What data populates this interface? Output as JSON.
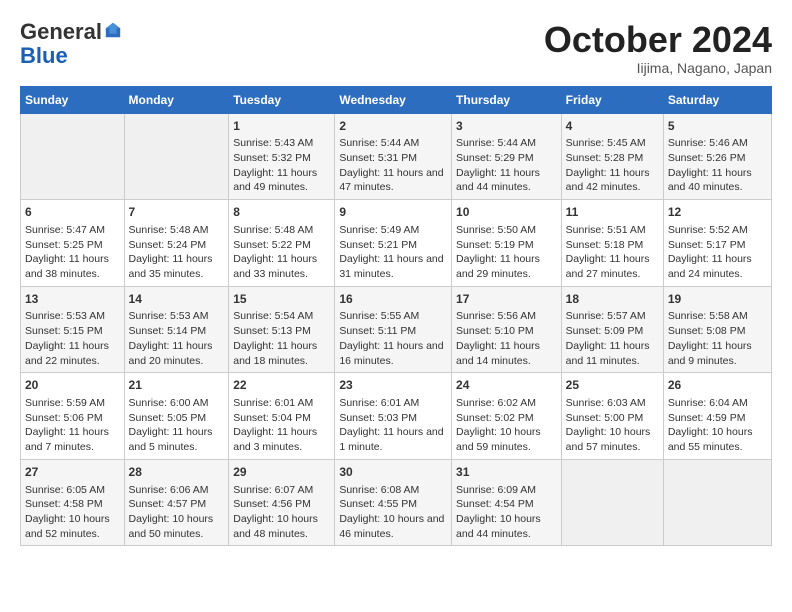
{
  "header": {
    "logo_line1": "General",
    "logo_line2": "Blue",
    "month_title": "October 2024",
    "location": "Iijima, Nagano, Japan"
  },
  "weekdays": [
    "Sunday",
    "Monday",
    "Tuesday",
    "Wednesday",
    "Thursday",
    "Friday",
    "Saturday"
  ],
  "weeks": [
    [
      {
        "day": "",
        "content": ""
      },
      {
        "day": "",
        "content": ""
      },
      {
        "day": "1",
        "content": "Sunrise: 5:43 AM\nSunset: 5:32 PM\nDaylight: 11 hours and 49 minutes."
      },
      {
        "day": "2",
        "content": "Sunrise: 5:44 AM\nSunset: 5:31 PM\nDaylight: 11 hours and 47 minutes."
      },
      {
        "day": "3",
        "content": "Sunrise: 5:44 AM\nSunset: 5:29 PM\nDaylight: 11 hours and 44 minutes."
      },
      {
        "day": "4",
        "content": "Sunrise: 5:45 AM\nSunset: 5:28 PM\nDaylight: 11 hours and 42 minutes."
      },
      {
        "day": "5",
        "content": "Sunrise: 5:46 AM\nSunset: 5:26 PM\nDaylight: 11 hours and 40 minutes."
      }
    ],
    [
      {
        "day": "6",
        "content": "Sunrise: 5:47 AM\nSunset: 5:25 PM\nDaylight: 11 hours and 38 minutes."
      },
      {
        "day": "7",
        "content": "Sunrise: 5:48 AM\nSunset: 5:24 PM\nDaylight: 11 hours and 35 minutes."
      },
      {
        "day": "8",
        "content": "Sunrise: 5:48 AM\nSunset: 5:22 PM\nDaylight: 11 hours and 33 minutes."
      },
      {
        "day": "9",
        "content": "Sunrise: 5:49 AM\nSunset: 5:21 PM\nDaylight: 11 hours and 31 minutes."
      },
      {
        "day": "10",
        "content": "Sunrise: 5:50 AM\nSunset: 5:19 PM\nDaylight: 11 hours and 29 minutes."
      },
      {
        "day": "11",
        "content": "Sunrise: 5:51 AM\nSunset: 5:18 PM\nDaylight: 11 hours and 27 minutes."
      },
      {
        "day": "12",
        "content": "Sunrise: 5:52 AM\nSunset: 5:17 PM\nDaylight: 11 hours and 24 minutes."
      }
    ],
    [
      {
        "day": "13",
        "content": "Sunrise: 5:53 AM\nSunset: 5:15 PM\nDaylight: 11 hours and 22 minutes."
      },
      {
        "day": "14",
        "content": "Sunrise: 5:53 AM\nSunset: 5:14 PM\nDaylight: 11 hours and 20 minutes."
      },
      {
        "day": "15",
        "content": "Sunrise: 5:54 AM\nSunset: 5:13 PM\nDaylight: 11 hours and 18 minutes."
      },
      {
        "day": "16",
        "content": "Sunrise: 5:55 AM\nSunset: 5:11 PM\nDaylight: 11 hours and 16 minutes."
      },
      {
        "day": "17",
        "content": "Sunrise: 5:56 AM\nSunset: 5:10 PM\nDaylight: 11 hours and 14 minutes."
      },
      {
        "day": "18",
        "content": "Sunrise: 5:57 AM\nSunset: 5:09 PM\nDaylight: 11 hours and 11 minutes."
      },
      {
        "day": "19",
        "content": "Sunrise: 5:58 AM\nSunset: 5:08 PM\nDaylight: 11 hours and 9 minutes."
      }
    ],
    [
      {
        "day": "20",
        "content": "Sunrise: 5:59 AM\nSunset: 5:06 PM\nDaylight: 11 hours and 7 minutes."
      },
      {
        "day": "21",
        "content": "Sunrise: 6:00 AM\nSunset: 5:05 PM\nDaylight: 11 hours and 5 minutes."
      },
      {
        "day": "22",
        "content": "Sunrise: 6:01 AM\nSunset: 5:04 PM\nDaylight: 11 hours and 3 minutes."
      },
      {
        "day": "23",
        "content": "Sunrise: 6:01 AM\nSunset: 5:03 PM\nDaylight: 11 hours and 1 minute."
      },
      {
        "day": "24",
        "content": "Sunrise: 6:02 AM\nSunset: 5:02 PM\nDaylight: 10 hours and 59 minutes."
      },
      {
        "day": "25",
        "content": "Sunrise: 6:03 AM\nSunset: 5:00 PM\nDaylight: 10 hours and 57 minutes."
      },
      {
        "day": "26",
        "content": "Sunrise: 6:04 AM\nSunset: 4:59 PM\nDaylight: 10 hours and 55 minutes."
      }
    ],
    [
      {
        "day": "27",
        "content": "Sunrise: 6:05 AM\nSunset: 4:58 PM\nDaylight: 10 hours and 52 minutes."
      },
      {
        "day": "28",
        "content": "Sunrise: 6:06 AM\nSunset: 4:57 PM\nDaylight: 10 hours and 50 minutes."
      },
      {
        "day": "29",
        "content": "Sunrise: 6:07 AM\nSunset: 4:56 PM\nDaylight: 10 hours and 48 minutes."
      },
      {
        "day": "30",
        "content": "Sunrise: 6:08 AM\nSunset: 4:55 PM\nDaylight: 10 hours and 46 minutes."
      },
      {
        "day": "31",
        "content": "Sunrise: 6:09 AM\nSunset: 4:54 PM\nDaylight: 10 hours and 44 minutes."
      },
      {
        "day": "",
        "content": ""
      },
      {
        "day": "",
        "content": ""
      }
    ]
  ]
}
